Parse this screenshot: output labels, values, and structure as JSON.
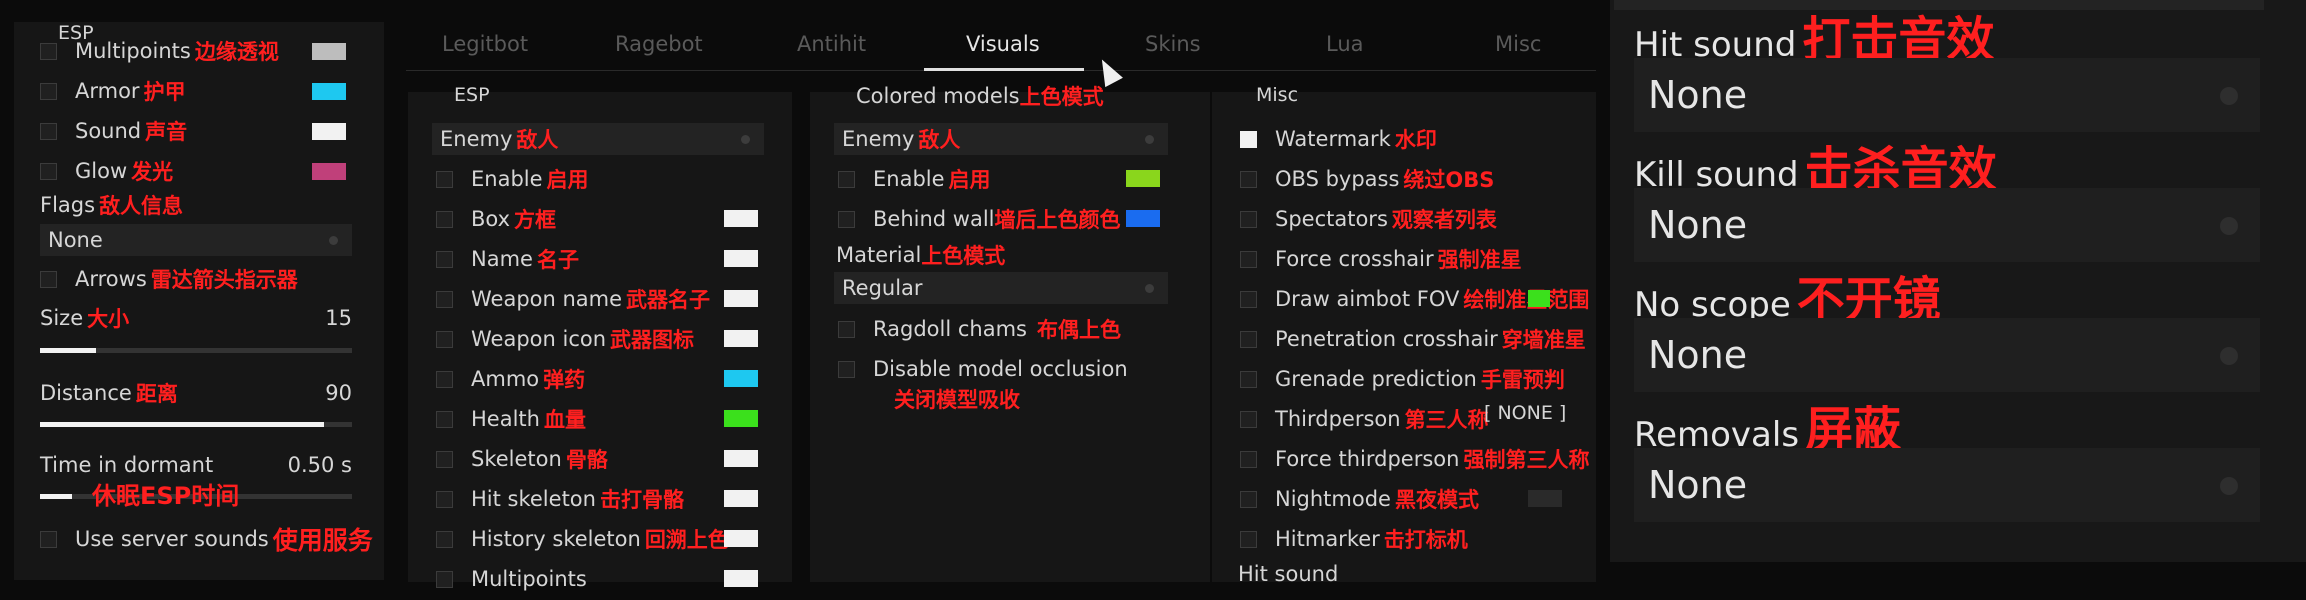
{
  "tabs": [
    "Legitbot",
    "Ragebot",
    "Antihit",
    "Visuals",
    "Skins",
    "Lua",
    "Misc"
  ],
  "active_tab": "Visuals",
  "left_panel": {
    "title": "ESP",
    "rows": [
      {
        "label": "Multipoints",
        "zh": "边缘透视",
        "color": "#bdbdbd"
      },
      {
        "label": "Armor",
        "zh": "护甲",
        "color": "#1ec8f0"
      },
      {
        "label": "Sound",
        "zh": "声音",
        "color": "#f2f2f2"
      },
      {
        "label": "Glow",
        "zh": "发光",
        "color": "#c0407a"
      }
    ],
    "flags_label": "Flags",
    "flags_zh": "敌人信息",
    "flags_value": "None",
    "arrows_label": "Arrows",
    "arrows_zh": "雷达箭头指示器",
    "size_label": "Size",
    "size_zh": "大小",
    "size_value": "15",
    "size_fraction": 0.18,
    "distance_label": "Distance",
    "distance_zh": "距离",
    "distance_value": "90",
    "distance_fraction": 0.91,
    "dormant_label": "Time in dormant",
    "dormant_value": "0.50 s",
    "dormant_zh": "休眠ESP时间",
    "dormant_fraction": 0.1,
    "server_sounds_label": "Use server sounds",
    "server_sounds_zh": "使用服务"
  },
  "esp": {
    "title": "ESP",
    "dropdown_label": "Enemy",
    "dropdown_zh": "敌人",
    "rows": [
      {
        "label": "Enable",
        "zh": "启用",
        "color": ""
      },
      {
        "label": "Box",
        "zh": "方框",
        "color": "#f2f2f2"
      },
      {
        "label": "Name",
        "zh": "名子",
        "color": "#f2f2f2"
      },
      {
        "label": "Weapon name",
        "zh": "武器名子",
        "color": "#f2f2f2"
      },
      {
        "label": "Weapon icon",
        "zh": "武器图标",
        "color": "#f2f2f2"
      },
      {
        "label": "Ammo",
        "zh": "弹药",
        "color": "#1ec8f0"
      },
      {
        "label": "Health",
        "zh": "血量",
        "color": "#3be01c"
      },
      {
        "label": "Skeleton",
        "zh": "骨骼",
        "color": "#f2f2f2"
      },
      {
        "label": "Hit skeleton",
        "zh": "击打骨骼",
        "color": "#f2f2f2"
      },
      {
        "label": "History skeleton",
        "zh": "回溯上色",
        "color": "#f2f2f2"
      },
      {
        "label": "Multipoints",
        "zh": "",
        "color": "#f2f2f2"
      }
    ]
  },
  "colored_models": {
    "title": "Colored models",
    "title_zh": "上色模式",
    "dropdown_label": "Enemy",
    "dropdown_zh": "敌人",
    "enable_label": "Enable",
    "enable_zh": "启用",
    "enable_color": "#8ad61c",
    "behind_label": "Behind wall",
    "behind_zh": "墙后上色颜色",
    "behind_color": "#1a6cf0",
    "material_label": "Material",
    "material_zh": "上色模式",
    "material_value": "Regular",
    "ragdoll_label": "Ragdoll chams",
    "ragdoll_zh": "布偶上色",
    "occlusion_label": "Disable model occlusion",
    "occlusion_zh": "关闭模型吸收"
  },
  "misc": {
    "title": "Misc",
    "rows": [
      {
        "label": "Watermark",
        "zh": "水印",
        "checked": true
      },
      {
        "label": "OBS bypass",
        "zh": "绕过OBS",
        "checked": false
      },
      {
        "label": "Spectators",
        "zh": "观察者列表",
        "checked": false
      },
      {
        "label": "Force crosshair",
        "zh": "强制准星",
        "checked": false
      },
      {
        "label": "Draw aimbot FOV",
        "zh": "绘制准星范围",
        "checked": false
      },
      {
        "label": "Penetration crosshair",
        "zh": "穿墙准星",
        "checked": false
      },
      {
        "label": "Grenade prediction",
        "zh": "手雷预判",
        "checked": false
      },
      {
        "label": "Thirdperson",
        "zh": "第三人称",
        "checked": false
      },
      {
        "label": "Force thirdperson",
        "zh": "强制第三人称",
        "checked": false
      },
      {
        "label": "Nightmode",
        "zh": "黑夜模式",
        "checked": false
      },
      {
        "label": "Hitmarker",
        "zh": "击打标机",
        "checked": false
      }
    ],
    "thirdperson_key": "[ NONE ]",
    "fov_color": "#3be01c",
    "hit_sound_label": "Hit sound"
  },
  "right_panel": {
    "items": [
      {
        "label": "Hit sound",
        "zh": "打击音效",
        "value": "None"
      },
      {
        "label": "Kill sound",
        "zh": "击杀音效",
        "value": "None"
      },
      {
        "label": "No scope",
        "zh": "不开镜",
        "value": "None"
      },
      {
        "label": "Removals",
        "zh": "屏蔽",
        "value": "None"
      }
    ]
  }
}
